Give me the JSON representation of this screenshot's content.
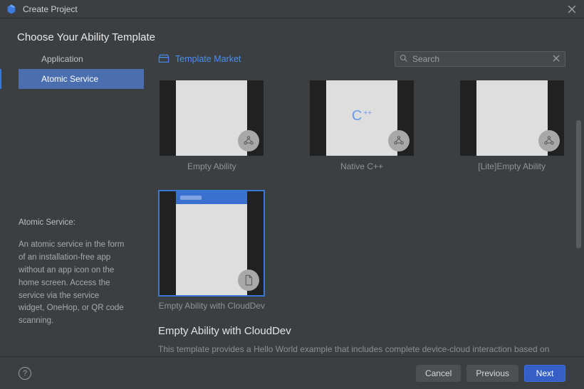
{
  "title": "Create Project",
  "heading": "Choose Your Ability Template",
  "sidebar": {
    "items": [
      {
        "label": "Application"
      },
      {
        "label": "Atomic Service"
      }
    ],
    "active_index": 1,
    "info_title": "Atomic Service:",
    "info_body": "An atomic service in the form of an installation-free app without an app icon on the home screen. Access the service via the service widget, OneHop, or QR code scanning."
  },
  "pane": {
    "template_market_label": "Template Market",
    "search_placeholder": "Search",
    "search_value": ""
  },
  "templates": [
    {
      "name": "Empty Ability",
      "kind": "nodes"
    },
    {
      "name": "Native C++",
      "kind": "cpp"
    },
    {
      "name": "[Lite]Empty Ability",
      "kind": "nodes"
    },
    {
      "name": "Empty Ability with CloudDev",
      "kind": "cloud"
    }
  ],
  "selected_index": 3,
  "details": {
    "title": "Empty Ability with CloudDev",
    "description": "This template provides a Hello World example that includes complete device-cloud interaction based on CloudDev capabilities. The cloud-side logic is hosted on the serverless service, which enables automatic scaling and O&M-free."
  },
  "footer": {
    "cancel": "Cancel",
    "previous": "Previous",
    "next": "Next"
  }
}
